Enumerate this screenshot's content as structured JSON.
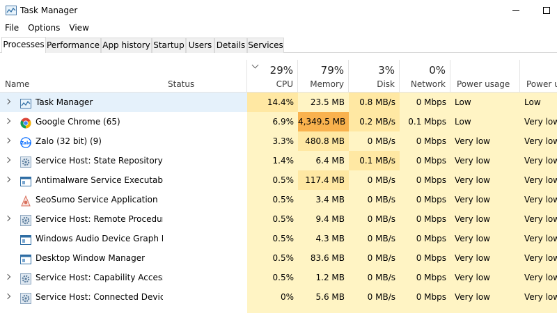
{
  "window": {
    "title": "Task Manager"
  },
  "menu": [
    "File",
    "Options",
    "View"
  ],
  "tabs": [
    {
      "label": "Processes",
      "active": true
    },
    {
      "label": "Performance"
    },
    {
      "label": "App history"
    },
    {
      "label": "Startup"
    },
    {
      "label": "Users"
    },
    {
      "label": "Details"
    },
    {
      "label": "Services"
    }
  ],
  "header": {
    "name": "Name",
    "status": "Status",
    "cpu": {
      "pct": "29%",
      "label": "CPU"
    },
    "memory": {
      "pct": "79%",
      "label": "Memory"
    },
    "disk": {
      "pct": "3%",
      "label": "Disk"
    },
    "network": {
      "pct": "0%",
      "label": "Network"
    },
    "power": "Power usage",
    "power_trend": "Power u"
  },
  "colors": {
    "heat_light": "#fff4c4",
    "heat_mid": "#ffe8a3",
    "heat_strong": "#ffd47a",
    "heat_max": "#f9b24e",
    "selected": "#e5f1fb",
    "chrome_red": "#db4437",
    "chrome_green": "#0f9d58",
    "chrome_yellow": "#f4b400",
    "chrome_blue": "#4285f4",
    "zalo_blue": "#0068ff"
  },
  "processes": [
    {
      "name": "Task Manager",
      "icon": "task-manager-icon",
      "expandable": true,
      "cpu": "14.4%",
      "memory": "23.5 MB",
      "disk": "0.8 MB/s",
      "network": "0 Mbps",
      "power": "Low",
      "power_trend": "Low"
    },
    {
      "name": "Google Chrome (65)",
      "icon": "chrome-icon",
      "expandable": true,
      "cpu": "6.9%",
      "memory": "4,349.5 MB",
      "disk": "0.2 MB/s",
      "network": "0.1 Mbps",
      "power": "Low",
      "power_trend": "Very low"
    },
    {
      "name": "Zalo (32 bit) (9)",
      "icon": "zalo-icon",
      "expandable": true,
      "cpu": "3.3%",
      "memory": "480.8 MB",
      "disk": "0 MB/s",
      "network": "0 Mbps",
      "power": "Very low",
      "power_trend": "Very low"
    },
    {
      "name": "Service Host: State Repository S...",
      "icon": "gear-icon",
      "expandable": true,
      "cpu": "1.4%",
      "memory": "6.4 MB",
      "disk": "0.1 MB/s",
      "network": "0 Mbps",
      "power": "Very low",
      "power_trend": "Very low"
    },
    {
      "name": "Antimalware Service Executable",
      "icon": "service-window-icon",
      "expandable": true,
      "cpu": "0.5%",
      "memory": "117.4 MB",
      "disk": "0 MB/s",
      "network": "0 Mbps",
      "power": "Very low",
      "power_trend": "Very low"
    },
    {
      "name": "SeoSumo Service Application",
      "icon": "seosumo-icon",
      "expandable": false,
      "cpu": "0.5%",
      "memory": "3.4 MB",
      "disk": "0 MB/s",
      "network": "0 Mbps",
      "power": "Very low",
      "power_trend": "Very low"
    },
    {
      "name": "Service Host: Remote Procedure...",
      "icon": "gear-icon",
      "expandable": true,
      "cpu": "0.5%",
      "memory": "9.4 MB",
      "disk": "0 MB/s",
      "network": "0 Mbps",
      "power": "Very low",
      "power_trend": "Very low"
    },
    {
      "name": "Windows Audio Device Graph Is...",
      "icon": "service-window-icon",
      "expandable": false,
      "cpu": "0.5%",
      "memory": "4.3 MB",
      "disk": "0 MB/s",
      "network": "0 Mbps",
      "power": "Very low",
      "power_trend": "Very low"
    },
    {
      "name": "Desktop Window Manager",
      "icon": "service-window-icon",
      "expandable": false,
      "cpu": "0.5%",
      "memory": "83.6 MB",
      "disk": "0 MB/s",
      "network": "0 Mbps",
      "power": "Very low",
      "power_trend": "Very low"
    },
    {
      "name": "Service Host: Capability Access ...",
      "icon": "gear-icon",
      "expandable": true,
      "cpu": "0.5%",
      "memory": "1.2 MB",
      "disk": "0 MB/s",
      "network": "0 Mbps",
      "power": "Very low",
      "power_trend": "Very low"
    },
    {
      "name": "Service Host: Connected Device...",
      "icon": "gear-icon",
      "expandable": true,
      "cpu": "0%",
      "memory": "5.6 MB",
      "disk": "0 MB/s",
      "network": "0 Mbps",
      "power": "Very low",
      "power_trend": "Very low"
    }
  ]
}
